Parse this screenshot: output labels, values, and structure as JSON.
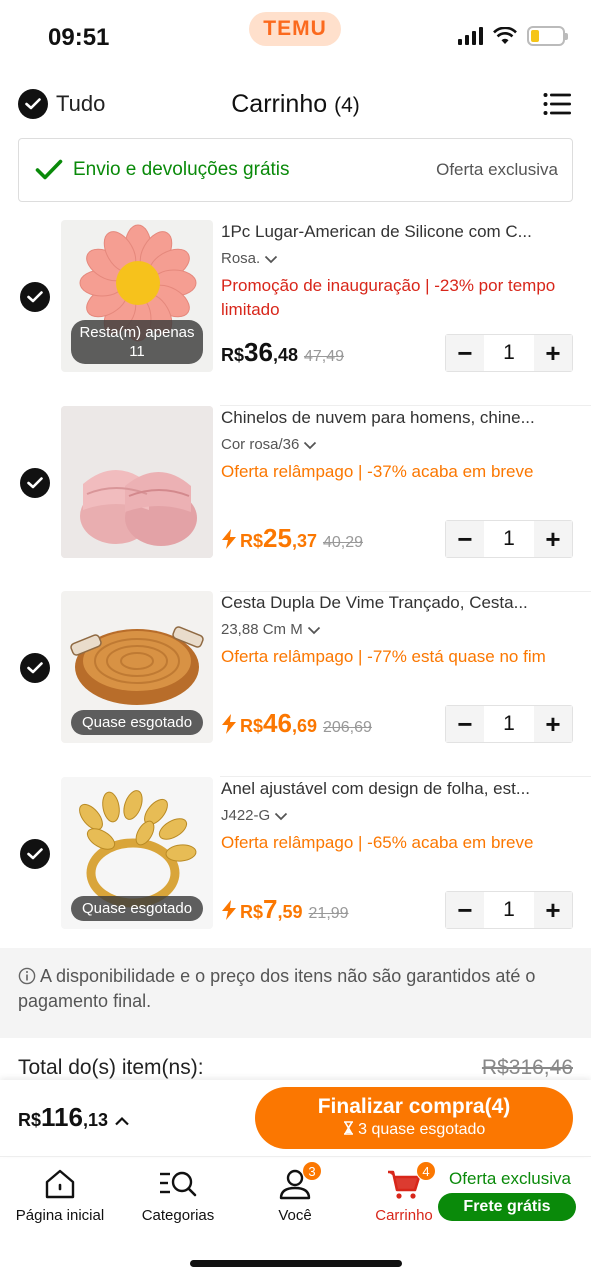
{
  "status_bar": {
    "time": "09:51",
    "app_badge": "TEMU"
  },
  "header": {
    "select_all_label": "Tudo",
    "title": "Carrinho",
    "count": "(4)"
  },
  "banner": {
    "text": "Envio e devoluções grátis",
    "offer": "Oferta exclusiva"
  },
  "items": [
    {
      "name": "1Pc Lugar-American de Silicone com C...",
      "variant": "Rosa.",
      "promo": "Promoção de inauguração | -23% por tempo limitado",
      "currency": "R$",
      "price_int": "36",
      "price_dec": ",48",
      "price_old": "47,49",
      "qty": "1",
      "badge": "Resta(m) apenas 11",
      "flash": false
    },
    {
      "name": "Chinelos de nuvem para homens, chine...",
      "variant": "Cor rosa/36",
      "promo": "Oferta relâmpago | -37% acaba em breve",
      "currency": "R$",
      "price_int": "25",
      "price_dec": ",37",
      "price_old": "40,29",
      "qty": "1",
      "badge": "",
      "flash": true
    },
    {
      "name": "Cesta Dupla De Vime Trançado, Cesta...",
      "variant": "23,88 Cm M",
      "promo": "Oferta relâmpago | -77% está quase no fim",
      "currency": "R$",
      "price_int": "46",
      "price_dec": ",69",
      "price_old": "206,69",
      "qty": "1",
      "badge": "Quase esgotado",
      "flash": true
    },
    {
      "name": "Anel ajustável com design de folha, est...",
      "variant": "J422-G",
      "promo": "Oferta relâmpago | -65% acaba em breve",
      "currency": "R$",
      "price_int": "7",
      "price_dec": ",59",
      "price_old": "21,99",
      "qty": "1",
      "badge": "Quase esgotado",
      "flash": true
    }
  ],
  "notice": "A disponibilidade e o preço dos itens não são garantidos até o pagamento final.",
  "totals": {
    "label": "Total do(s) item(ns):",
    "old": "R$316,46",
    "currency": "R$",
    "int": "116",
    "dec": ",13"
  },
  "checkout": {
    "main": "Finalizar compra(4)",
    "sub": "3 quase esgotado"
  },
  "nav": {
    "home": "Página inicial",
    "categories": "Categorias",
    "you": "Você",
    "you_badge": "3",
    "cart": "Carrinho",
    "cart_badge": "4",
    "promo_title": "Oferta exclusiva",
    "promo_pill": "Frete grátis"
  },
  "colors": {
    "accent": "#fb7701",
    "red": "#d8261a",
    "green": "#0a8a0a"
  }
}
